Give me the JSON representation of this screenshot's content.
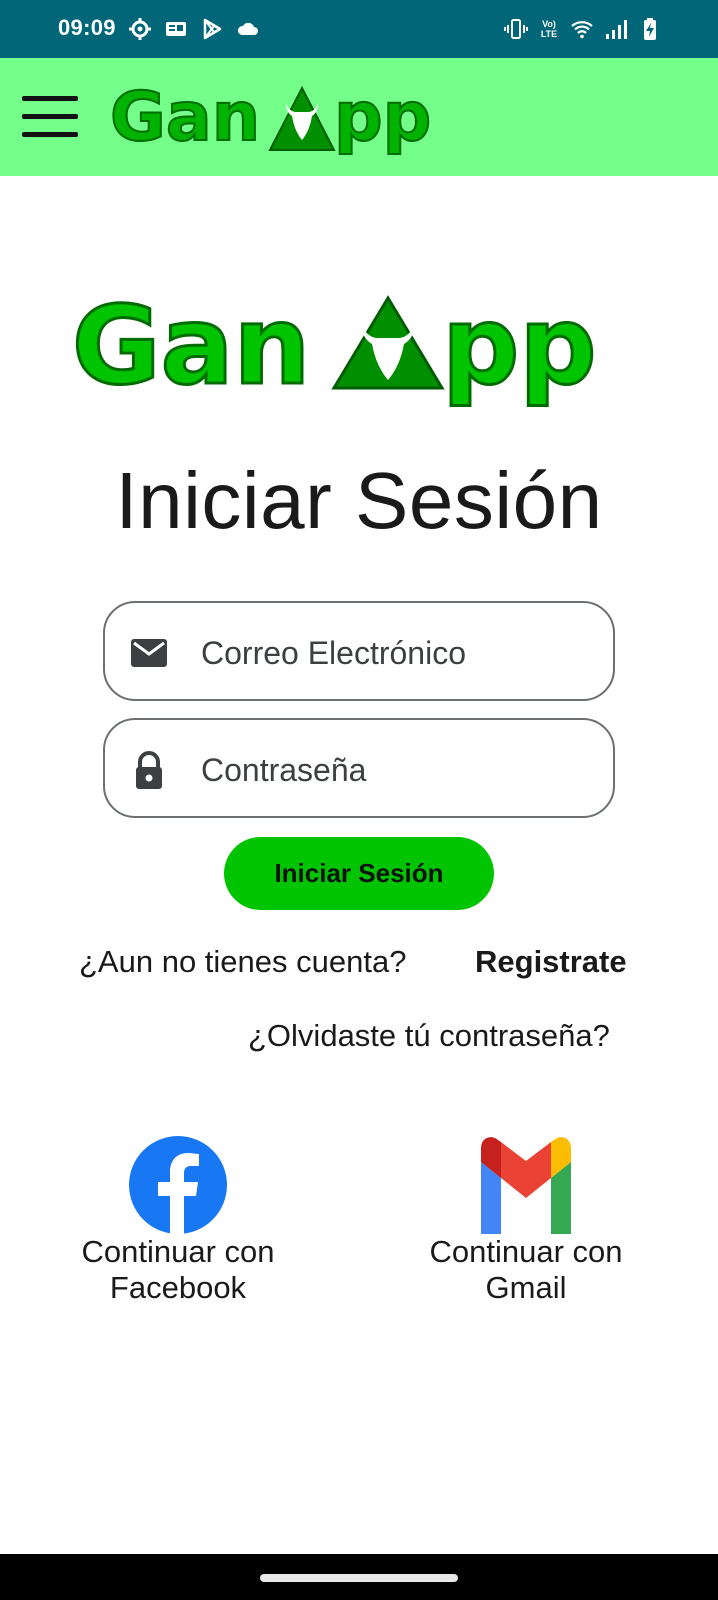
{
  "status_bar": {
    "time": "09:09",
    "left_icons": [
      "gear-icon",
      "news-icon",
      "play-store-icon",
      "cloud-icon"
    ],
    "volte_top": "Vo)",
    "volte_bottom": "LTE",
    "right_icons": [
      "vibrate-icon",
      "volte-icon",
      "wifi-icon",
      "signal-icon",
      "battery-charging-icon"
    ],
    "color": "#016778"
  },
  "app_bar": {
    "menu_icon": "hamburger-menu-icon",
    "logo_text_left": "Gan",
    "logo_text_right": "pp",
    "color": "#74ff8a"
  },
  "main_logo": {
    "text_left": "Gan",
    "text_right": "pp"
  },
  "title": "Iniciar Sesión",
  "form": {
    "email_placeholder": "Correo Electrónico",
    "email_icon": "email-icon",
    "password_placeholder": "Contraseña",
    "password_icon": "lock-icon",
    "submit_label": "Iniciar Sesión",
    "submit_color": "#00c400"
  },
  "links": {
    "register_question": "¿Aun no tienes cuenta?",
    "register_label": "Registrate",
    "forgot_password": "¿Olvidaste tú contraseña?"
  },
  "social": {
    "facebook": {
      "icon": "facebook-icon",
      "line1": "Continuar con",
      "line2": "Facebook"
    },
    "gmail": {
      "icon": "gmail-icon",
      "line1": "Continuar con",
      "line2": "Gmail"
    }
  }
}
